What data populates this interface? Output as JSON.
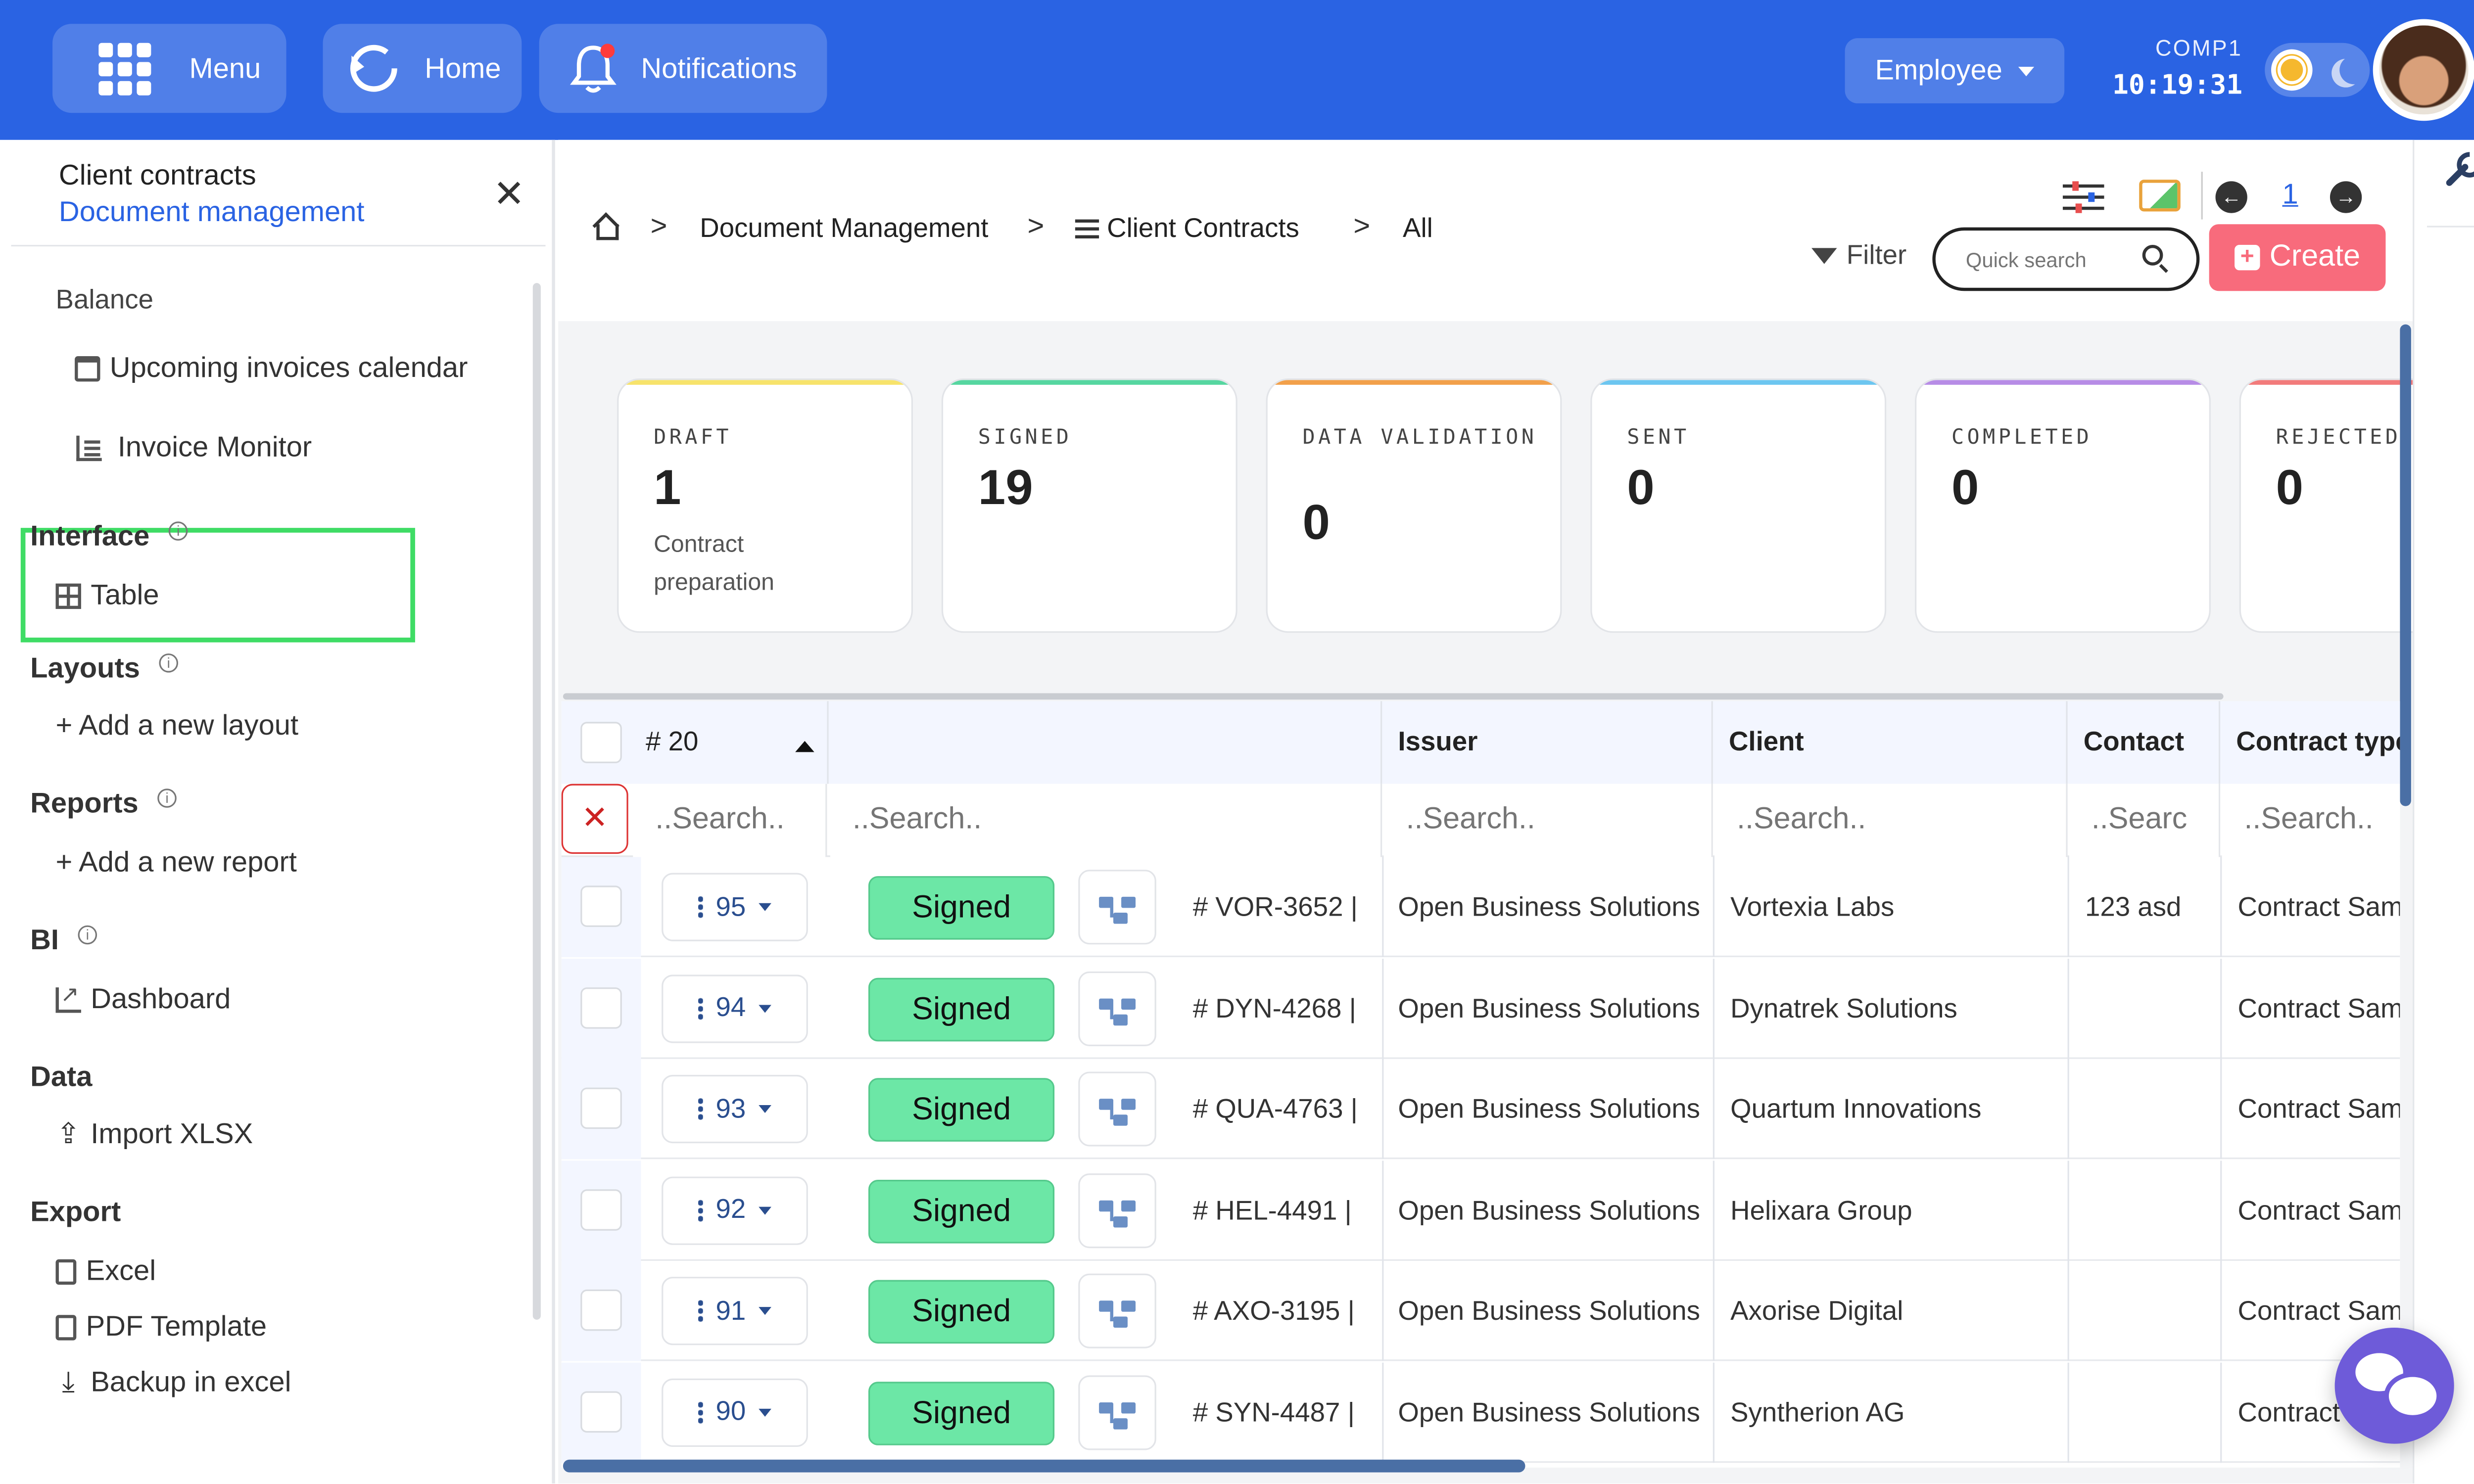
{
  "topbar": {
    "menu_label": "Menu",
    "home_label": "Home",
    "notifications_label": "Notifications",
    "role_label": "Employee",
    "company": "COMP1",
    "clock": "10:19:31"
  },
  "sidebar": {
    "title": "Client contracts",
    "subtitle": "Document management",
    "balance": "Balance",
    "upcoming": "Upcoming invoices calendar",
    "invoice_monitor": "Invoice Monitor",
    "interface": "Interface",
    "table": "Table",
    "layouts": "Layouts",
    "add_layout": "+ Add a new layout",
    "reports": "Reports",
    "add_report": "+ Add a new report",
    "bi": "BI",
    "dashboard": "Dashboard",
    "data": "Data",
    "import_xlsx": "Import XLSX",
    "export": "Export",
    "excel": "Excel",
    "pdf_template": "PDF Template",
    "backup": "Backup in excel",
    "info_glyph": "i"
  },
  "breadcrumb": {
    "doc_mgmt": "Document Management",
    "client_contracts": "Client Contracts",
    "all": "All",
    "separator": ">"
  },
  "toolbar": {
    "page": "1",
    "filter": "Filter",
    "search_placeholder": "Quick search",
    "create": "Create"
  },
  "cards": [
    {
      "title": "DRAFT",
      "value": "1",
      "sub": "Contract preparation",
      "color": "#f7e36b"
    },
    {
      "title": "SIGNED",
      "value": "19",
      "sub": "",
      "color": "#56d6a0"
    },
    {
      "title": "DATA VALIDATION",
      "value": "0",
      "sub": "",
      "color": "#f2a04a"
    },
    {
      "title": "SENT",
      "value": "0",
      "sub": "",
      "color": "#6cc6f0"
    },
    {
      "title": "COMPLETED",
      "value": "0",
      "sub": "",
      "color": "#b78ce6"
    },
    {
      "title": "REJECTED",
      "value": "0",
      "sub": "",
      "color": "#f27b7b"
    }
  ],
  "table": {
    "count_header": "# 20",
    "headers": {
      "issuer": "Issuer",
      "client": "Client",
      "contact": "Contact",
      "contract_type": "Contract type"
    },
    "search_placeholders": {
      "col1": "..Search..",
      "col2": "..Search..",
      "issuer": "..Search..",
      "client": "..Search..",
      "contact": "..Searc",
      "contract_type": "..Search.."
    },
    "rows": [
      {
        "num": "95",
        "status": "Signed",
        "code": "# VOR-3652 |",
        "issuer": "Open Business Solutions",
        "client": "Vortexia Labs",
        "contact": "123 asd",
        "type": "Contract Sam"
      },
      {
        "num": "94",
        "status": "Signed",
        "code": "# DYN-4268 |",
        "issuer": "Open Business Solutions",
        "client": "Dynatrek Solutions",
        "contact": "",
        "type": "Contract Sam"
      },
      {
        "num": "93",
        "status": "Signed",
        "code": "# QUA-4763 |",
        "issuer": "Open Business Solutions",
        "client": "Quartum Innovations",
        "contact": "",
        "type": "Contract Sam"
      },
      {
        "num": "92",
        "status": "Signed",
        "code": "# HEL-4491 |",
        "issuer": "Open Business Solutions",
        "client": "Helixara Group",
        "contact": "",
        "type": "Contract Sam"
      },
      {
        "num": "91",
        "status": "Signed",
        "code": "# AXO-3195 |",
        "issuer": "Open Business Solutions",
        "client": "Axorise Digital",
        "contact": "",
        "type": "Contract Sam"
      },
      {
        "num": "90",
        "status": "Signed",
        "code": "# SYN-4487 |",
        "issuer": "Open Business Solutions",
        "client": "Syntherion AG",
        "contact": "",
        "type": "Contract"
      }
    ]
  },
  "colors": {
    "brand": "#2a63e3",
    "create": "#f86b7c",
    "signed": "#6ce7a6",
    "highlight": "#3fdc65"
  }
}
